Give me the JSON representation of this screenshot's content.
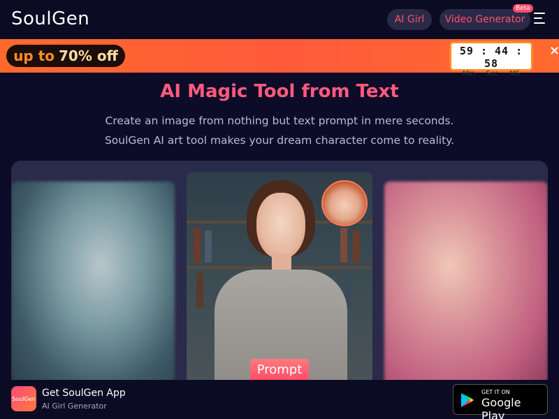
{
  "header": {
    "logo": "SoulGen",
    "nav": {
      "ai_girl": "AI Girl",
      "video_generator": "Video Generator",
      "beta": "Beta"
    }
  },
  "promo": {
    "text_prefix": "up to",
    "text_percent": "70% off",
    "timer": {
      "min": "59",
      "sec": "44",
      "ms": "58",
      "sep": ":",
      "label_min": "Min",
      "label_sec": "Sec",
      "label_ms": "MS"
    },
    "close": "×"
  },
  "hero": {
    "title": "AI Magic Tool from Text",
    "subtitle_line1": "Create an image from nothing but text prompt in mere seconds.",
    "subtitle_line2": "SoulGen AI art tool makes your dream character come to reality."
  },
  "gallery": {
    "prompt_label": "Prompt"
  },
  "appbar": {
    "icon_text": "SoulGen",
    "title": "Get SoulGen App",
    "subtitle": "AI Girl Generator",
    "store_small": "GET IT ON",
    "store_big": "Google Play"
  },
  "colors": {
    "accent": "#ff4f6a",
    "promo_orange": "#ff6a2b",
    "bg": "#0c0c28"
  },
  "icons": {
    "menu": "hamburger-menu-icon",
    "close": "close-icon",
    "store": "google-play-icon"
  }
}
